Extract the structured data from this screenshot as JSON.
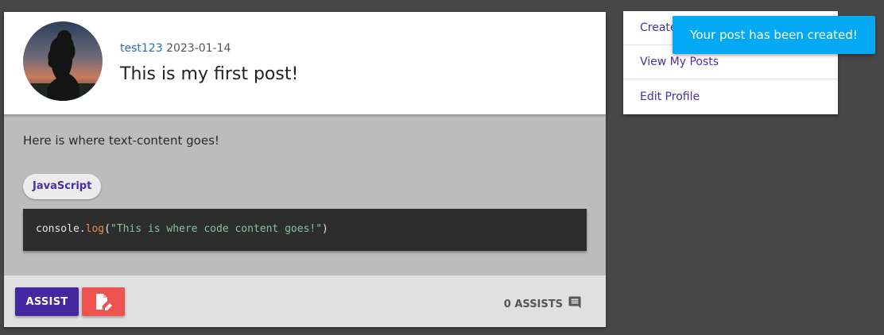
{
  "post": {
    "username": "test123",
    "date": "2023-01-14",
    "title": "This is my first post!",
    "text_content": "Here is where text-content goes!",
    "tag": "JavaScript",
    "code": {
      "object": "console",
      "dot": ".",
      "method": "log",
      "open_paren": "(",
      "string": "\"This is where code content goes!\"",
      "close_paren": ")"
    }
  },
  "footer": {
    "assist_label": "ASSIST",
    "assists_count_label": "0 ASSISTS",
    "edit_icon": "edit-document-icon",
    "comment_icon": "comment-icon"
  },
  "side_menu": {
    "items": [
      {
        "label": "Create Post"
      },
      {
        "label": "View My Posts"
      },
      {
        "label": "Edit Profile"
      }
    ]
  },
  "toast": {
    "message": "Your post has been created!"
  },
  "colors": {
    "accent_purple": "#4527a0",
    "link_blue": "#2a6db4",
    "edit_red": "#ef5350",
    "toast_blue": "#03a9f4",
    "background": "#474747"
  }
}
